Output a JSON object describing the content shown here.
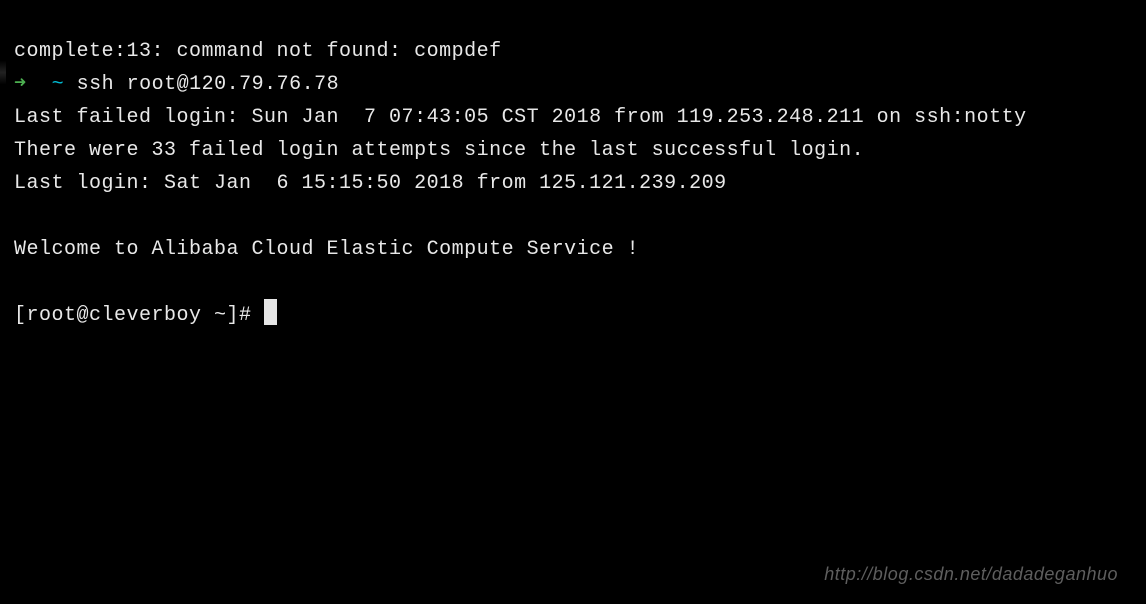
{
  "terminal": {
    "error_line": "complete:13: command not found: compdef",
    "prompt_arrow": "➜",
    "prompt_tilde": "~",
    "ssh_command": "ssh root@120.79.76.78",
    "last_failed_login": "Last failed login: Sun Jan  7 07:43:05 CST 2018 from 119.253.248.211 on ssh:notty",
    "failed_attempts": "There were 33 failed login attempts since the last successful login.",
    "last_login": "Last login: Sat Jan  6 15:15:50 2018 from 125.121.239.209",
    "welcome": "Welcome to Alibaba Cloud Elastic Compute Service !",
    "shell_prompt": "[root@cleverboy ~]# "
  },
  "watermark": "http://blog.csdn.net/dadadeganhuo"
}
